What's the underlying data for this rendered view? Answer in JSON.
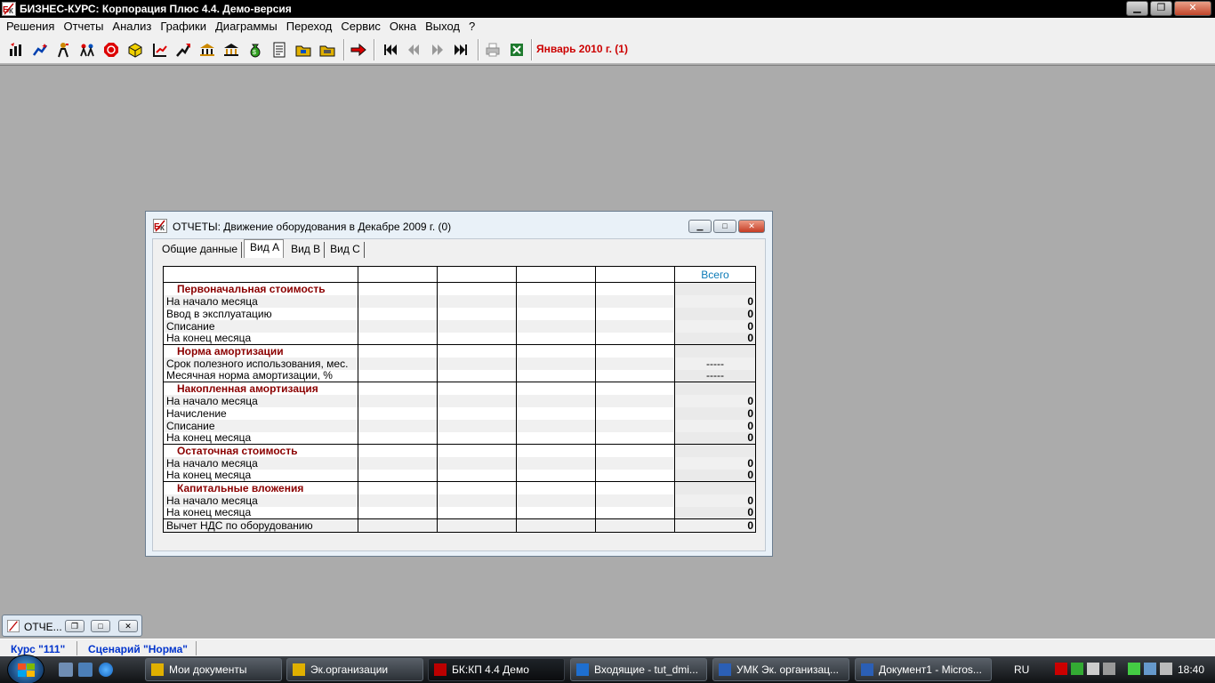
{
  "window": {
    "title": "БИЗНЕС-КУРС: Корпорация Плюс 4.4. Демо-версия"
  },
  "menu": [
    "Решения",
    "Отчеты",
    "Анализ",
    "Графики",
    "Диаграммы",
    "Переход",
    "Сервис",
    "Окна",
    "Выход",
    "?"
  ],
  "toolbar": {
    "icons": [
      "decisions-icon",
      "star-chart-icon",
      "people-icon",
      "team-icon",
      "stop-sign-icon",
      "box-icon",
      "chart-up-icon",
      "trend-icon",
      "bank-icon",
      "bank-2-icon",
      "money-bag-icon",
      "document-icon",
      "folder-icon",
      "printer-folder-icon",
      "arrow-right-icon",
      "first-icon",
      "prev-icon",
      "next-icon",
      "last-icon",
      "print-icon",
      "excel-icon"
    ],
    "period": "Январь 2010 г. (1)"
  },
  "report": {
    "title": "ОТЧЕТЫ: Движение оборудования в Декабре 2009 г. (0)",
    "tabs": [
      "Общие данные",
      "Вид А",
      "Вид В",
      "Вид С"
    ],
    "active_tab": "Вид А",
    "total_header": "Всего",
    "sections": [
      {
        "title": "Первоначальная стоимость",
        "rows": [
          {
            "label": "На начало месяца",
            "total": "0"
          },
          {
            "label": "Ввод в эксплуатацию",
            "total": "0"
          },
          {
            "label": "Списание",
            "total": "0"
          },
          {
            "label": "На конец месяца",
            "total": "0"
          }
        ]
      },
      {
        "title": "Норма амортизации",
        "rows": [
          {
            "label": "Срок полезного использования, мес.",
            "total": "-----"
          },
          {
            "label": "Месячная норма амортизации, %",
            "total": "-----"
          }
        ]
      },
      {
        "title": "Накопленная амортизация",
        "rows": [
          {
            "label": "На начало месяца",
            "total": "0"
          },
          {
            "label": "Начисление",
            "total": "0"
          },
          {
            "label": "Списание",
            "total": "0"
          },
          {
            "label": "На конец месяца",
            "total": "0"
          }
        ]
      },
      {
        "title": "Остаточная стоимость",
        "rows": [
          {
            "label": "На начало месяца",
            "total": "0"
          },
          {
            "label": "На конец месяца",
            "total": "0"
          }
        ]
      },
      {
        "title": "Капитальные вложения",
        "rows": [
          {
            "label": "На начало месяца",
            "total": "0"
          },
          {
            "label": "На конец месяца",
            "total": "0"
          }
        ]
      }
    ],
    "footer_row": {
      "label": "Вычет НДС по оборудованию",
      "total": "0"
    }
  },
  "minimized": {
    "label": "ОТЧЕ..."
  },
  "status": {
    "course": "Курс \"111\"",
    "scenario": "Сценарий \"Норма\""
  },
  "taskbar": {
    "tasks": [
      {
        "label": "Мои документы",
        "active": false
      },
      {
        "label": "Эк.организации",
        "active": false
      },
      {
        "label": "БК:КП 4.4 Демо",
        "active": true
      },
      {
        "label": "Входящие - tut_dmi...",
        "active": false
      },
      {
        "label": "УМК Эк. организац...",
        "active": false
      },
      {
        "label": "Документ1 - Micros...",
        "active": false
      }
    ],
    "lang": "RU",
    "clock": "18:40"
  }
}
